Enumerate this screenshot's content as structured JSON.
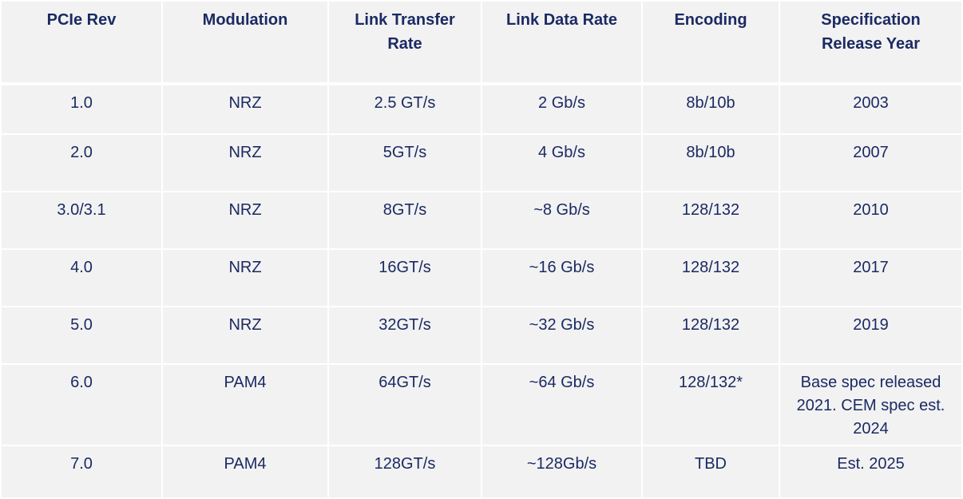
{
  "headers": [
    "PCIe Rev",
    "Modulation",
    "Link Transfer Rate",
    "Link Data Rate",
    "Encoding",
    "Specification Release Year"
  ],
  "rows": [
    [
      "1.0",
      "NRZ",
      "2.5 GT/s",
      "2 Gb/s",
      "8b/10b",
      "2003"
    ],
    [
      "2.0",
      "NRZ",
      "5GT/s",
      "4 Gb/s",
      "8b/10b",
      "2007"
    ],
    [
      "3.0/3.1",
      "NRZ",
      "8GT/s",
      "~8 Gb/s",
      "128/132",
      "2010"
    ],
    [
      "4.0",
      "NRZ",
      "16GT/s",
      "~16 Gb/s",
      "128/132",
      "2017"
    ],
    [
      "5.0",
      "NRZ",
      "32GT/s",
      "~32 Gb/s",
      "128/132",
      "2019"
    ],
    [
      "6.0",
      "PAM4",
      "64GT/s",
      "~64 Gb/s",
      "128/132*",
      "Base spec released 2021. CEM spec est. 2024"
    ],
    [
      "7.0",
      "PAM4",
      "128GT/s",
      "~128Gb/s",
      "TBD",
      "Est. 2025"
    ]
  ],
  "colors": {
    "text": "#1b2a63",
    "cell": "#f2f2f2",
    "border": "#ffffff"
  }
}
